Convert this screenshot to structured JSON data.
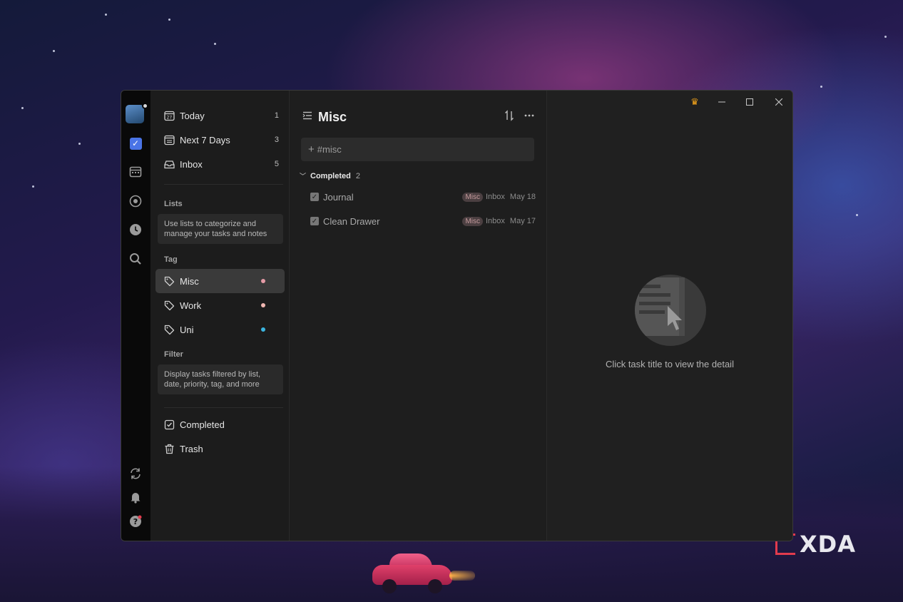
{
  "watermark": {
    "text": "XDA"
  },
  "rail": {
    "icons": [
      "checkbox-icon",
      "calendar-icon",
      "focus-icon",
      "clock-icon",
      "search-icon",
      "sync-icon",
      "bell-icon",
      "help-icon"
    ]
  },
  "sidebar": {
    "smart_lists": [
      {
        "label": "Today",
        "count": "1",
        "icon": "calendar-day-icon"
      },
      {
        "label": "Next 7 Days",
        "count": "3",
        "icon": "calendar-week-icon"
      },
      {
        "label": "Inbox",
        "count": "5",
        "icon": "inbox-icon"
      }
    ],
    "lists_title": "Lists",
    "lists_hint": "Use lists to categorize and manage your tasks and notes",
    "tag_title": "Tag",
    "tags": [
      {
        "label": "Misc",
        "color": "#e59aa6",
        "active": true
      },
      {
        "label": "Work",
        "color": "#f0b7b1",
        "active": false
      },
      {
        "label": "Uni",
        "color": "#3bb4df",
        "active": false
      }
    ],
    "filter_title": "Filter",
    "filter_hint": "Display tasks filtered by list, date, priority, tag, and more",
    "bottom_items": [
      {
        "label": "Completed",
        "icon": "checkbox-outline-icon"
      },
      {
        "label": "Trash",
        "icon": "trash-icon"
      }
    ]
  },
  "main": {
    "title": "Misc",
    "add_placeholder": "#misc",
    "group": {
      "title": "Completed",
      "count": "2"
    },
    "tasks": [
      {
        "title": "Journal",
        "tag": "Misc",
        "list": "Inbox",
        "date": "May 18"
      },
      {
        "title": "Clean Drawer",
        "tag": "Misc",
        "list": "Inbox",
        "date": "May 17"
      }
    ]
  },
  "detail": {
    "empty_text": "Click task title to view the detail"
  },
  "colors": {
    "accent": "#4a74e6",
    "premium": "#f2a31a"
  }
}
